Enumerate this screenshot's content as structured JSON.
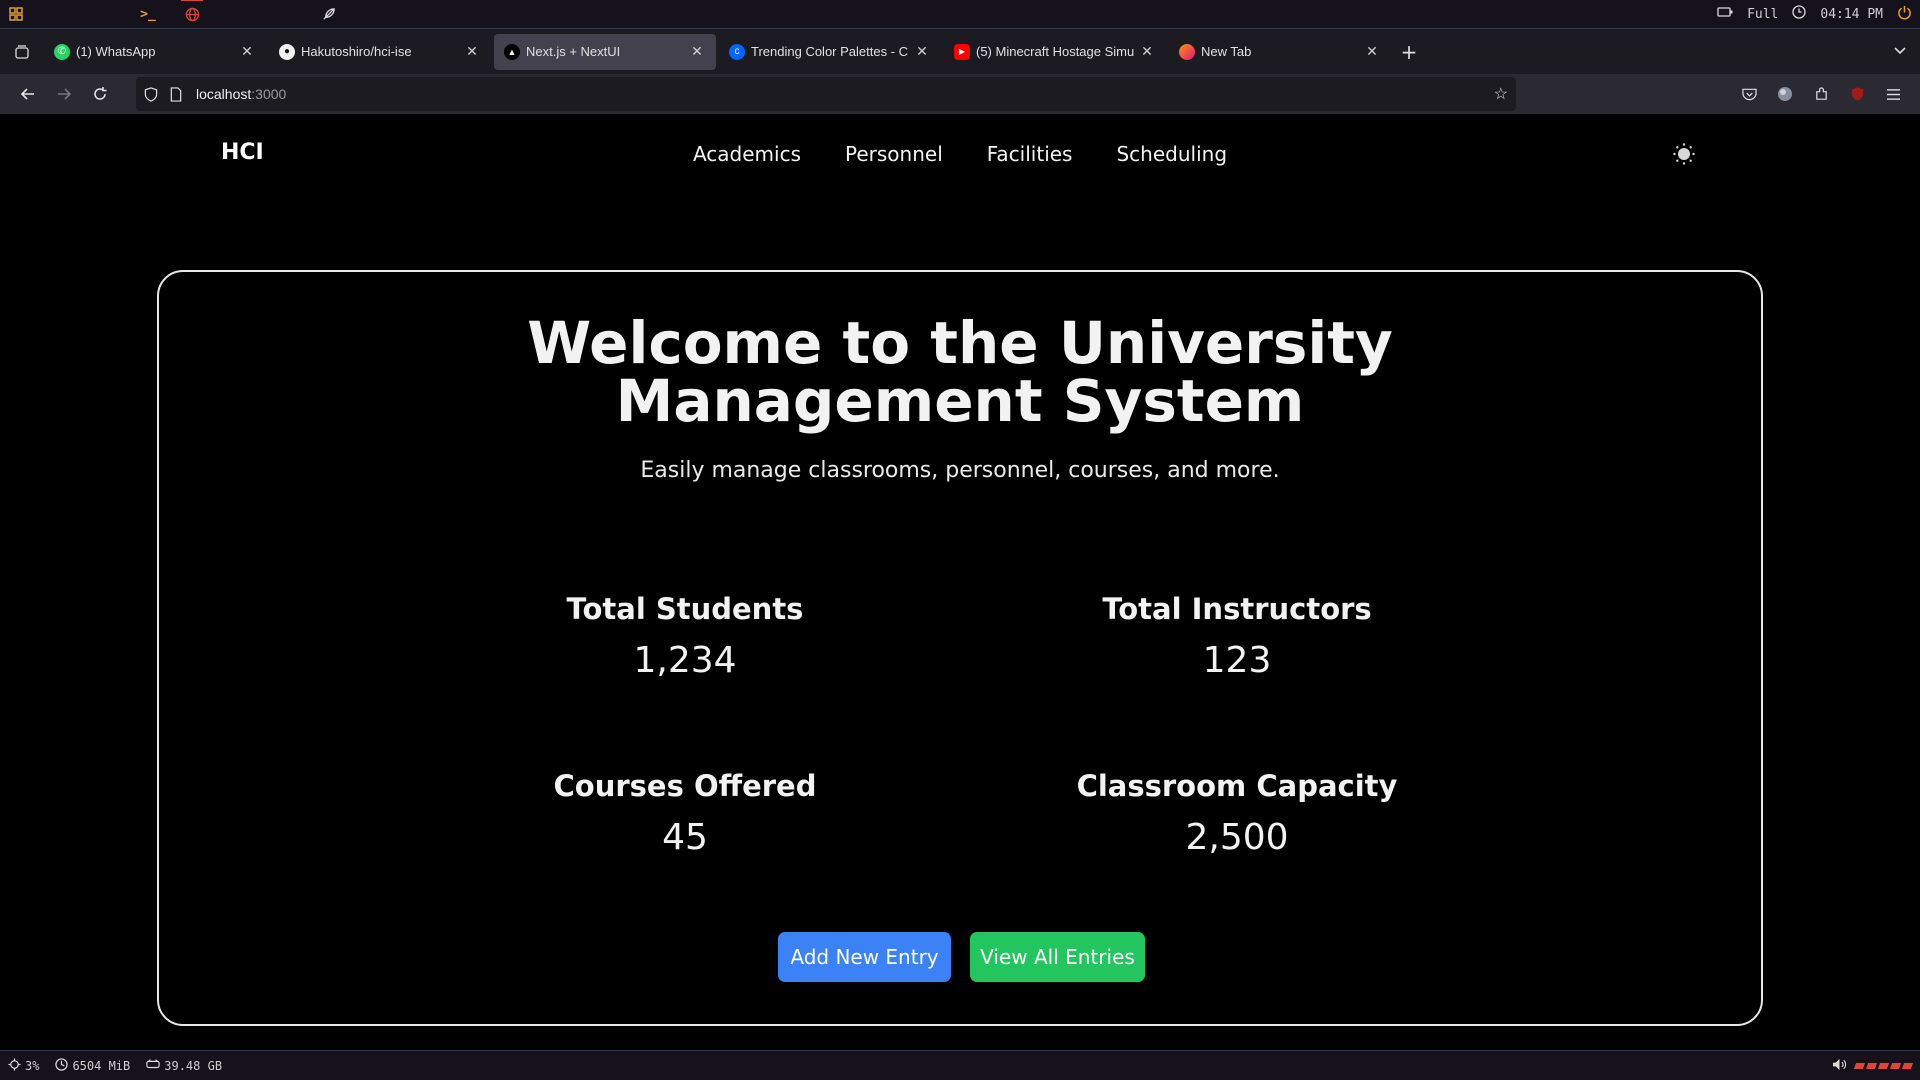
{
  "system_bar": {
    "battery_label": "Full",
    "clock": "04:14 PM"
  },
  "tabs": [
    {
      "title": "(1) WhatsApp",
      "icon": "whatsapp-icon"
    },
    {
      "title": "Hakutoshiro/hci-ise",
      "icon": "github-icon"
    },
    {
      "title": "Next.js + NextUI",
      "icon": "nextui-icon"
    },
    {
      "title": "Trending Color Palettes - C",
      "icon": "coolors-icon"
    },
    {
      "title": "(5) Minecraft Hostage Simu",
      "icon": "youtube-icon"
    },
    {
      "title": "New Tab",
      "icon": "firefox-icon"
    }
  ],
  "address_bar": {
    "host": "localhost",
    "port": ":3000"
  },
  "site": {
    "brand": "HCI",
    "nav": [
      "Academics",
      "Personnel",
      "Facilities",
      "Scheduling"
    ]
  },
  "hero": {
    "title_line1": "Welcome to the University",
    "title_line2": "Management System",
    "subtitle": "Easily manage classrooms, personnel, courses, and more."
  },
  "stats": [
    {
      "label": "Total Students",
      "value": "1,234"
    },
    {
      "label": "Total Instructors",
      "value": "123"
    },
    {
      "label": "Courses Offered",
      "value": "45"
    },
    {
      "label": "Classroom Capacity",
      "value": "2,500"
    }
  ],
  "actions": {
    "add": "Add New Entry",
    "view": "View All Entries"
  },
  "status_bar": {
    "cpu": "3%",
    "memory": "6504 MiB",
    "disk": "39.48 GB"
  },
  "colors": {
    "primary_button": "#3b82f6",
    "success_button": "#22c55e",
    "accent_red": "#e0443a"
  }
}
